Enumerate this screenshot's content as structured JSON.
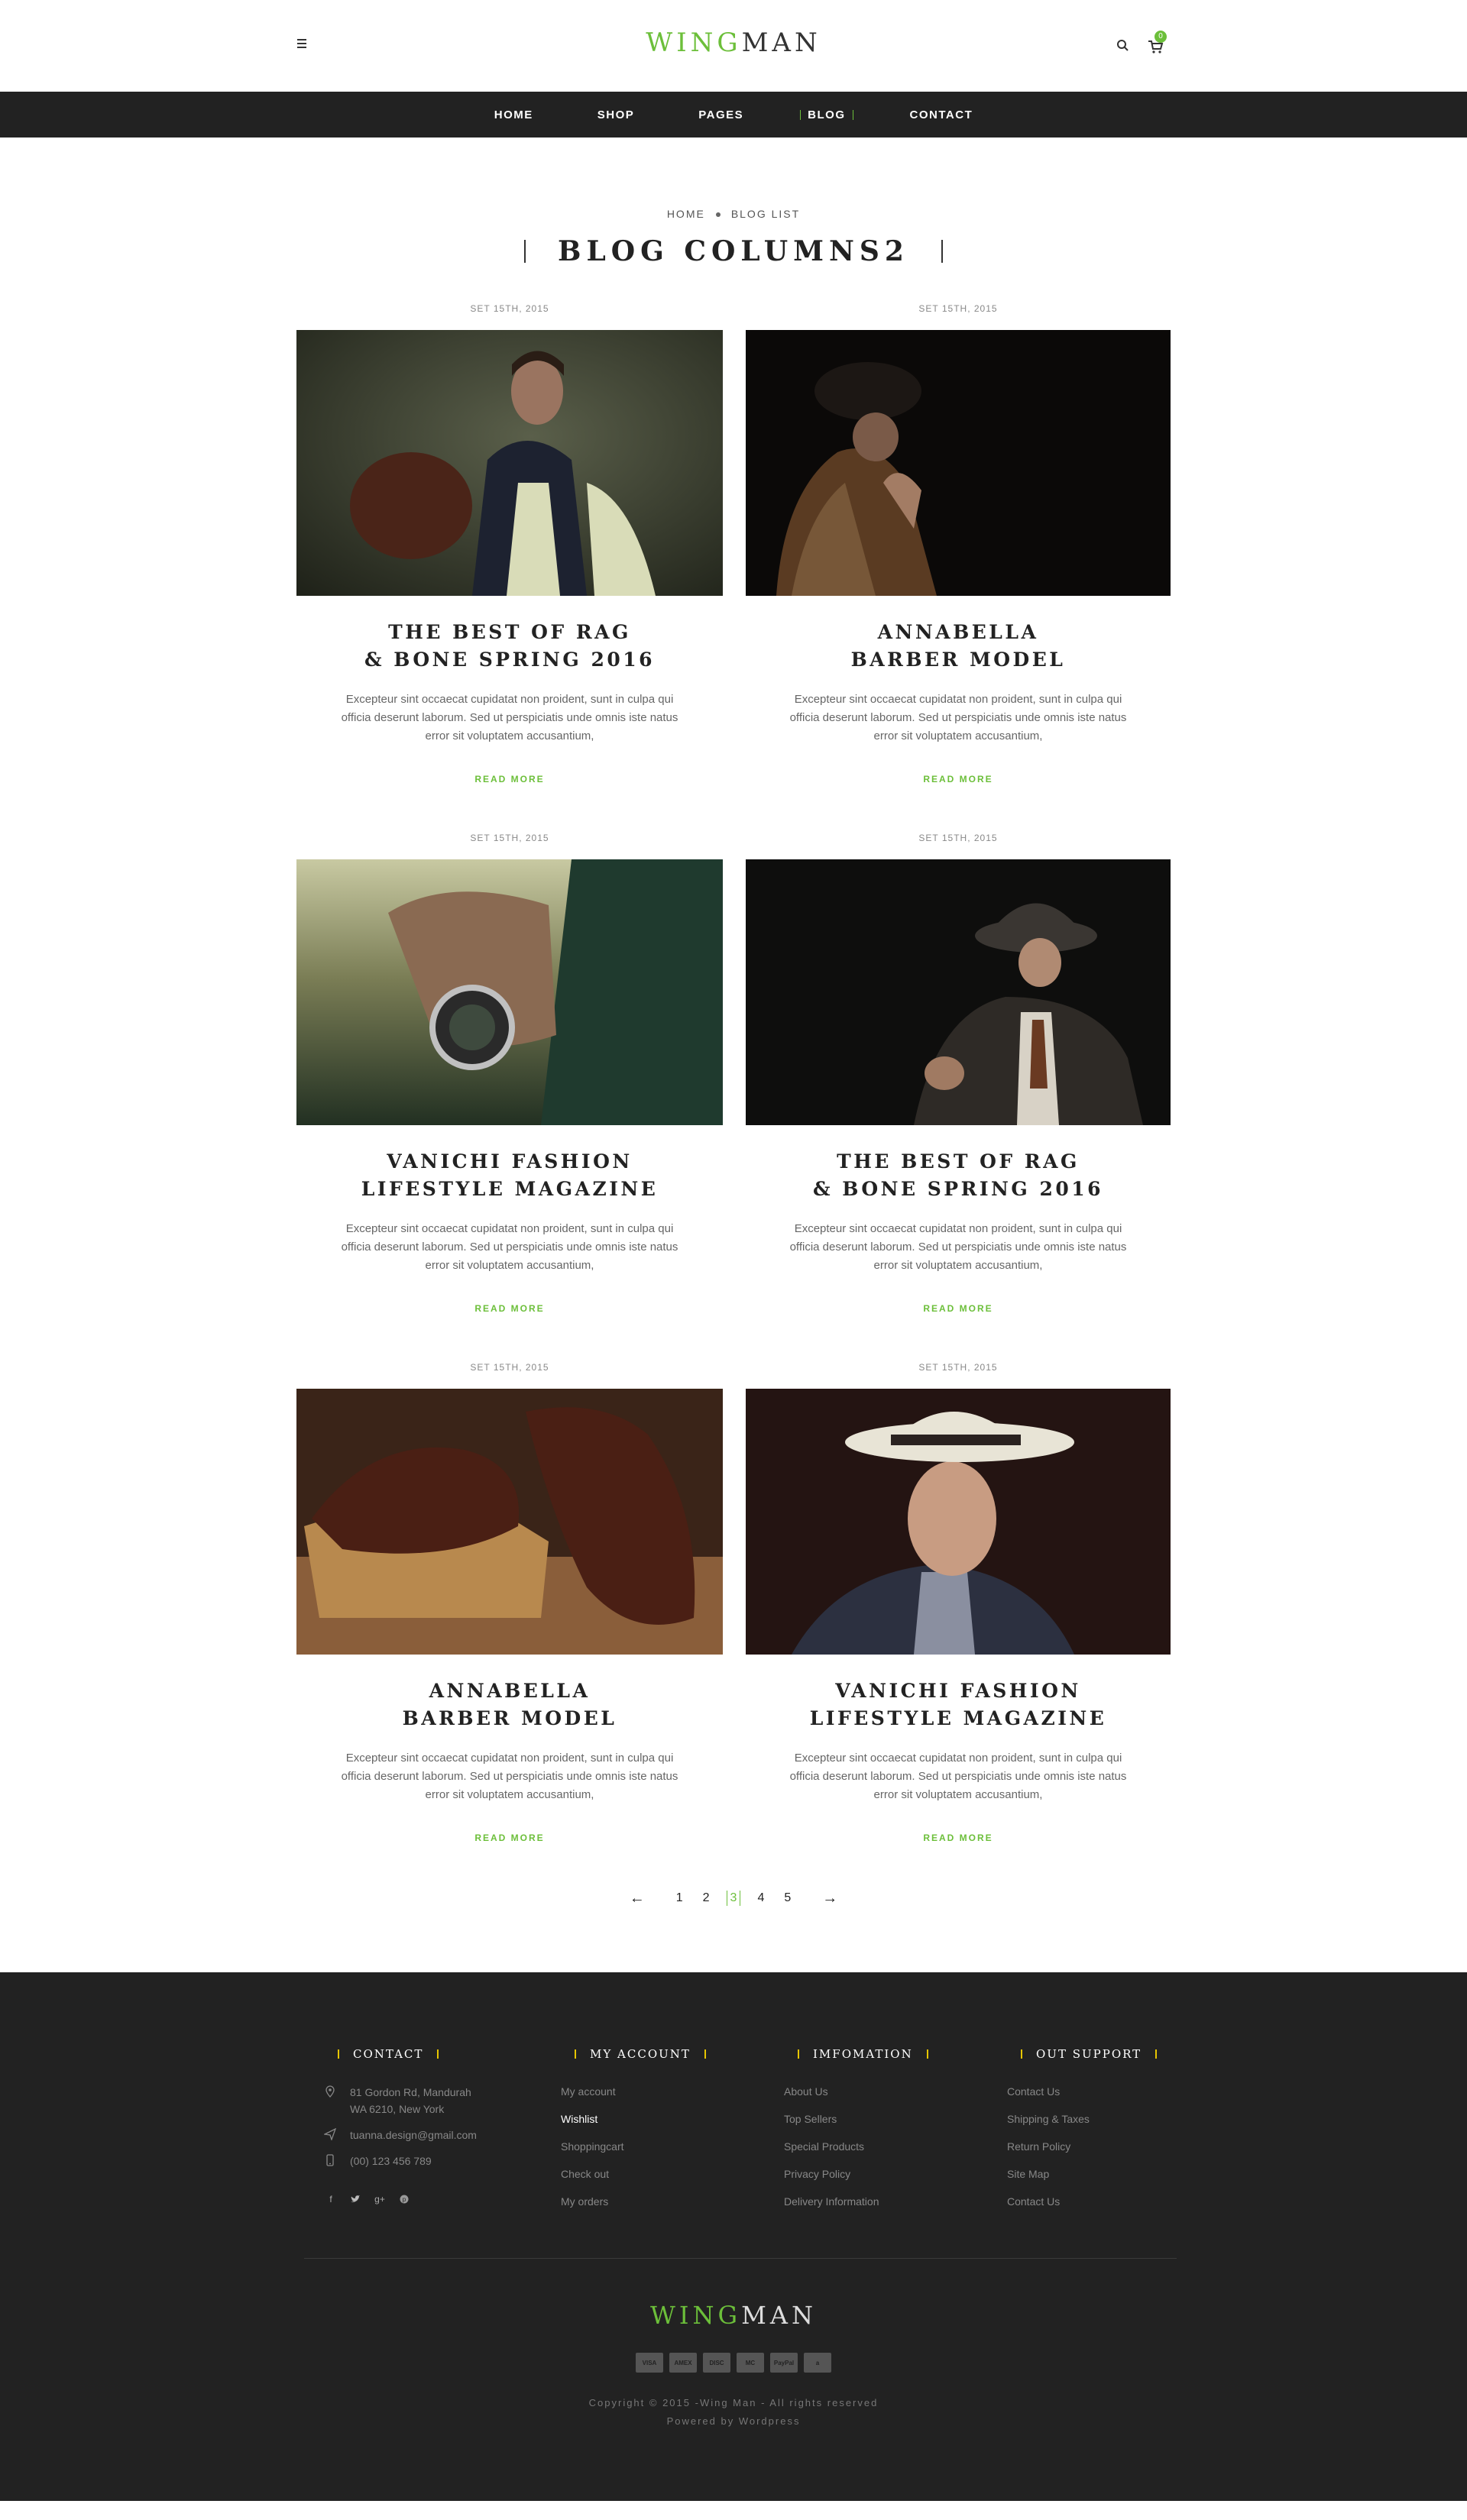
{
  "header": {
    "logo_first": "WING",
    "logo_second": "MAN",
    "cart_count": "0"
  },
  "nav": {
    "items": [
      "HOME",
      "SHOP",
      "PAGES",
      "BLOG",
      "CONTACT"
    ],
    "active": "BLOG"
  },
  "title_section": {
    "breadcrumb": [
      "HOME",
      "BLOG LIST"
    ],
    "title": "BLOG COLUMNS2"
  },
  "posts": [
    {
      "date": "SET 15TH, 2015",
      "title_line1": "THE BEST OF RAG",
      "title_line2": "& BONE SPRING 2016",
      "excerpt": "Excepteur sint occaecat cupidatat non proident, sunt in culpa qui officia deserunt laborum. Sed ut perspiciatis unde omnis iste natus error sit voluptatem accusantium,",
      "read_more": "READ MORE"
    },
    {
      "date": "SET 15TH, 2015",
      "title_line1": "ANNABELLA",
      "title_line2": "BARBER MODEL",
      "excerpt": "Excepteur sint occaecat cupidatat non proident, sunt in culpa qui officia deserunt laborum. Sed ut perspiciatis unde omnis iste natus error sit voluptatem accusantium,",
      "read_more": "READ MORE"
    },
    {
      "date": "SET 15TH, 2015",
      "title_line1": "VANICHI FASHION",
      "title_line2": "LIFESTYLE MAGAZINE",
      "excerpt": "Excepteur sint occaecat cupidatat non proident, sunt in culpa qui officia deserunt laborum. Sed ut perspiciatis unde omnis iste natus error sit voluptatem accusantium,",
      "read_more": "READ MORE"
    },
    {
      "date": "SET 15TH, 2015",
      "title_line1": "THE BEST OF RAG",
      "title_line2": "& BONE SPRING 2016",
      "excerpt": "Excepteur sint occaecat cupidatat non proident, sunt in culpa qui officia deserunt laborum. Sed ut perspiciatis unde omnis iste natus error sit voluptatem accusantium,",
      "read_more": "READ MORE"
    },
    {
      "date": "SET 15TH, 2015",
      "title_line1": "ANNABELLA",
      "title_line2": "BARBER MODEL",
      "excerpt": "Excepteur sint occaecat cupidatat non proident, sunt in culpa qui officia deserunt laborum. Sed ut perspiciatis unde omnis iste natus error sit voluptatem accusantium,",
      "read_more": "READ MORE"
    },
    {
      "date": "SET 15TH, 2015",
      "title_line1": "VANICHI FASHION",
      "title_line2": "LIFESTYLE MAGAZINE",
      "excerpt": "Excepteur sint occaecat cupidatat non proident, sunt in culpa qui officia deserunt laborum. Sed ut perspiciatis unde omnis iste natus error sit voluptatem accusantium,",
      "read_more": "READ MORE"
    }
  ],
  "pagination": {
    "prev": "←",
    "next": "→",
    "pages": [
      "1",
      "2",
      "3",
      "4",
      "5"
    ],
    "current": "3"
  },
  "footer": {
    "contact": {
      "heading": "CONTACT",
      "address_line1": "81 Gordon Rd, Mandurah",
      "address_line2": "WA 6210, New York",
      "email": "tuanna.design@gmail.com",
      "phone": "(00) 123 456 789"
    },
    "account": {
      "heading": "MY ACCOUNT",
      "links": [
        "My account",
        "Wishlist",
        "Shoppingcart",
        "Check out",
        "My orders"
      ],
      "active": "Wishlist"
    },
    "information": {
      "heading": "IMFOMATION",
      "links": [
        "About Us",
        "Top Sellers",
        "Special Products",
        "Privacy Policy",
        "Delivery Information"
      ]
    },
    "support": {
      "heading": "OUT SUPPORT",
      "links": [
        "Contact Us",
        "Shipping & Taxes",
        "Return Policy",
        "Site Map",
        "Contact Us"
      ]
    },
    "logo_first": "WING",
    "logo_second": "MAN",
    "payments": [
      "VISA",
      "AMEX",
      "DISC",
      "MC",
      "PayPal",
      "a"
    ],
    "copyright": "Copyright © 2015 -Wing Man - All rights reserved",
    "powered": "Powered by Wordpress"
  },
  "colors": {
    "accent": "#6cbf3a",
    "nav_bg": "#222222",
    "footer_bg": "#222222",
    "footer_bar": "#e6c500"
  }
}
